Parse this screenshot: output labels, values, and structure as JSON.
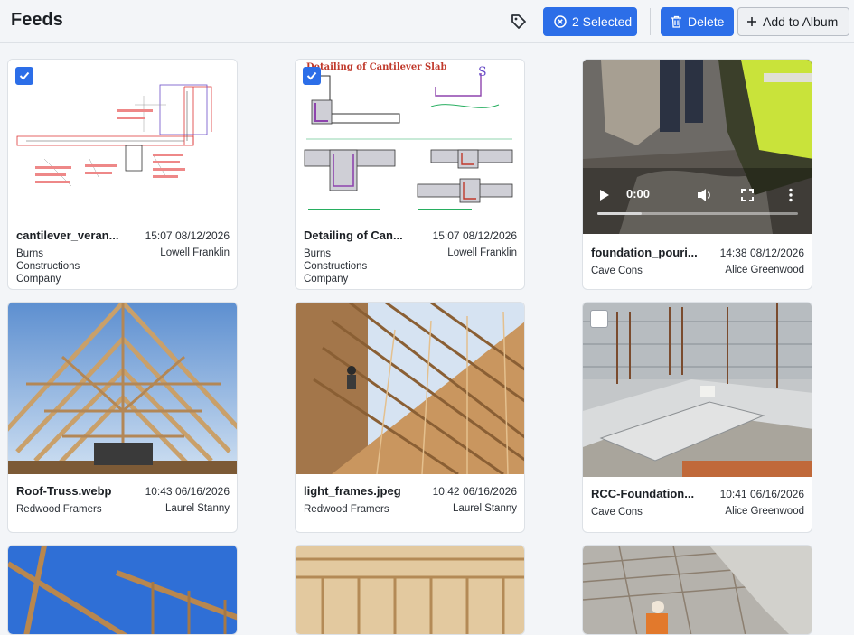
{
  "header": {
    "title": "Feeds",
    "selected_label": "2 Selected",
    "delete_label": "Delete",
    "add_album_label": "Add to Album"
  },
  "feeds": [
    {
      "name": "cantilever_veran...",
      "time": "15:07 08/12/2026",
      "company": "Burns Constructions Company",
      "user": "Lowell Franklin",
      "selected": true
    },
    {
      "name": "Detailing of Can...",
      "time": "15:07 08/12/2026",
      "company": "Burns Constructions Company",
      "user": "Lowell Franklin",
      "selected": true,
      "thumb_title": "Detailing of Cantilever Slab"
    },
    {
      "name": "foundation_pouri...",
      "time": "14:38 08/12/2026",
      "company": "Cave Cons",
      "user": "Alice Greenwood",
      "type": "video",
      "video_time": "0:00",
      "video_progress": 0.22
    },
    {
      "name": "Roof-Truss.webp",
      "time": "10:43 06/16/2026",
      "company": "Redwood Framers",
      "user": "Laurel Stanny"
    },
    {
      "name": "light_frames.jpeg",
      "time": "10:42 06/16/2026",
      "company": "Redwood Framers",
      "user": "Laurel Stanny"
    },
    {
      "name": "RCC-Foundation...",
      "time": "10:41 06/16/2026",
      "company": "Cave Cons",
      "user": "Alice Greenwood",
      "selected": false
    }
  ],
  "colors": {
    "primary": "#2c6ee8",
    "card_border": "#dde1e6",
    "background": "#f3f5f8"
  }
}
